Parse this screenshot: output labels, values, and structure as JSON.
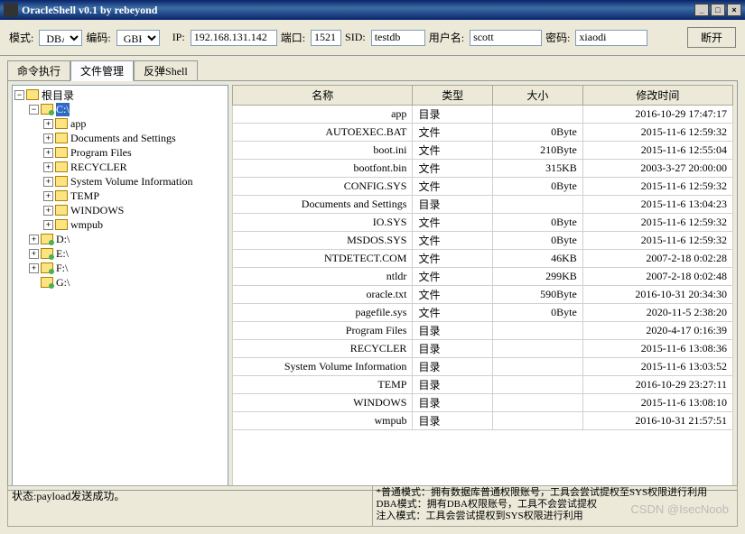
{
  "window": {
    "title": "OracleShell v0.1  by rebeyond",
    "minimize": "_",
    "maximize": "□",
    "close": "×"
  },
  "toolbar": {
    "mode_label": "模式:",
    "mode_value": "DBA",
    "enc_label": "编码:",
    "enc_value": "GBK",
    "ip_label": "IP:",
    "ip_value": "192.168.131.142",
    "port_label": "端口:",
    "port_value": "1521",
    "sid_label": "SID:",
    "sid_value": "testdb",
    "user_label": "用户名:",
    "user_value": "scott",
    "pass_label": "密码:",
    "pass_value": "xiaodi",
    "disconnect": "断开"
  },
  "tabs": {
    "cmd": "命令执行",
    "file": "文件管理",
    "shell": "反弹Shell"
  },
  "tree": {
    "root": "根目录",
    "c": "C:\\",
    "c_children": [
      "app",
      "Documents and Settings",
      "Program Files",
      "RECYCLER",
      "System Volume Information",
      "TEMP",
      "WINDOWS",
      "wmpub"
    ],
    "d": "D:\\",
    "e": "E:\\",
    "f": "F:\\",
    "g": "G:\\"
  },
  "table": {
    "headers": {
      "name": "名称",
      "type": "类型",
      "size": "大小",
      "time": "修改时间"
    },
    "rows": [
      {
        "name": "app",
        "type": "目录",
        "size": "",
        "time": "2016-10-29 17:47:17"
      },
      {
        "name": "AUTOEXEC.BAT",
        "type": "文件",
        "size": "0Byte",
        "time": "2015-11-6 12:59:32"
      },
      {
        "name": "boot.ini",
        "type": "文件",
        "size": "210Byte",
        "time": "2015-11-6 12:55:04"
      },
      {
        "name": "bootfont.bin",
        "type": "文件",
        "size": "315KB",
        "time": "2003-3-27 20:00:00"
      },
      {
        "name": "CONFIG.SYS",
        "type": "文件",
        "size": "0Byte",
        "time": "2015-11-6 12:59:32"
      },
      {
        "name": "Documents and Settings",
        "type": "目录",
        "size": "",
        "time": "2015-11-6 13:04:23"
      },
      {
        "name": "IO.SYS",
        "type": "文件",
        "size": "0Byte",
        "time": "2015-11-6 12:59:32"
      },
      {
        "name": "MSDOS.SYS",
        "type": "文件",
        "size": "0Byte",
        "time": "2015-11-6 12:59:32"
      },
      {
        "name": "NTDETECT.COM",
        "type": "文件",
        "size": "46KB",
        "time": "2007-2-18 0:02:28"
      },
      {
        "name": "ntldr",
        "type": "文件",
        "size": "299KB",
        "time": "2007-2-18 0:02:48"
      },
      {
        "name": "oracle.txt",
        "type": "文件",
        "size": "590Byte",
        "time": "2016-10-31 20:34:30"
      },
      {
        "name": "pagefile.sys",
        "type": "文件",
        "size": "0Byte",
        "time": "2020-11-5 2:38:20"
      },
      {
        "name": "Program Files",
        "type": "目录",
        "size": "",
        "time": "2020-4-17 0:16:39"
      },
      {
        "name": "RECYCLER",
        "type": "目录",
        "size": "",
        "time": "2015-11-6 13:08:36"
      },
      {
        "name": "System Volume Information",
        "type": "目录",
        "size": "",
        "time": "2015-11-6 13:03:52"
      },
      {
        "name": "TEMP",
        "type": "目录",
        "size": "",
        "time": "2016-10-29 23:27:11"
      },
      {
        "name": "WINDOWS",
        "type": "目录",
        "size": "",
        "time": "2015-11-6 13:08:10"
      },
      {
        "name": "wmpub",
        "type": "目录",
        "size": "",
        "time": "2016-10-31 21:57:51"
      }
    ]
  },
  "status": {
    "left": "状态:payload发送成功。",
    "right1": "*普通模式：拥有数据库普通权限账号，工具会尝试提权至SYS权限进行利用",
    "right2": "DBA模式：拥有DBA权限账号，工具不会尝试提权",
    "right3": "注入模式：工具会尝试提权到SYS权限进行利用"
  },
  "watermark": "CSDN @IsecNoob"
}
